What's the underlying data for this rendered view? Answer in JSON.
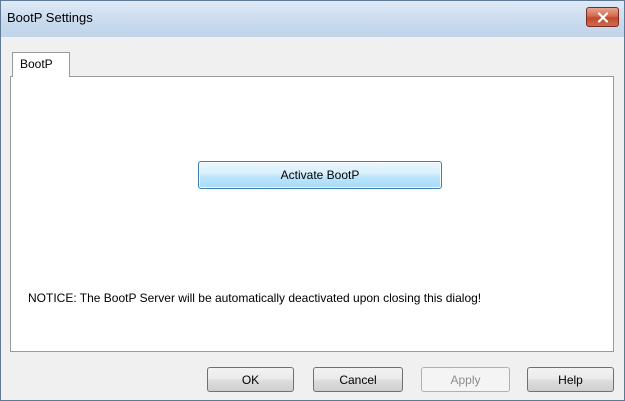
{
  "window": {
    "title": "BootP Settings"
  },
  "tabs": [
    {
      "label": "BootP",
      "active": true
    }
  ],
  "panel": {
    "activate_label": "Activate BootP",
    "notice": "NOTICE:  The BootP Server will be automatically deactivated upon closing this dialog!"
  },
  "footer": {
    "ok_label": "OK",
    "cancel_label": "Cancel",
    "apply_label": "Apply",
    "help_label": "Help"
  },
  "icons": {
    "close": "close-icon"
  },
  "colors": {
    "close_button": "#c9553b",
    "activate_border": "#3c7fb1"
  }
}
